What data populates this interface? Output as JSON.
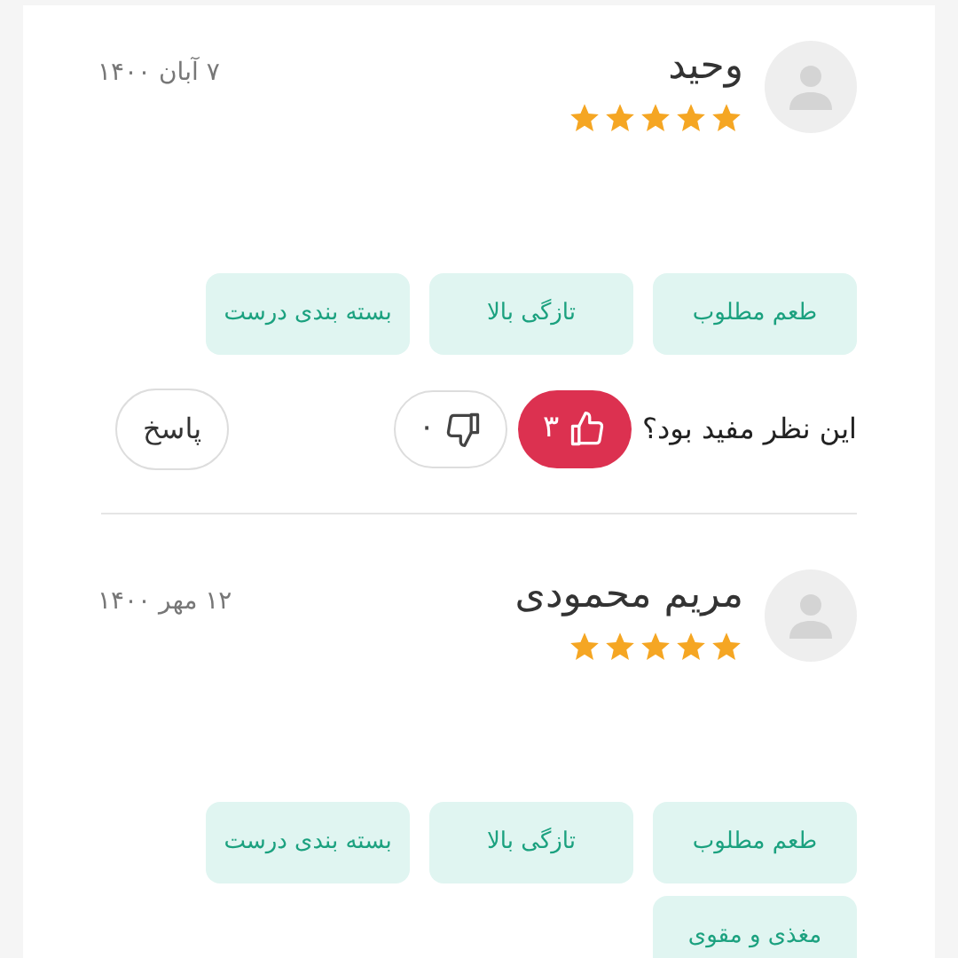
{
  "reviews": [
    {
      "name": "وحید",
      "stars": 5,
      "date": "۷ آبان ۱۴۰۰",
      "tags": [
        "طعم مطلوب",
        "تازگی بالا",
        "بسته بندی درست"
      ],
      "helpful": {
        "question": "این نظر مفید بود؟",
        "likes": "۳",
        "liked": true,
        "dislikes": "۰",
        "disliked": false,
        "reply": "پاسخ"
      }
    },
    {
      "name": "مریم محمودی",
      "stars": 5,
      "date": "۱۲ مهر ۱۴۰۰",
      "tags": [
        "طعم مطلوب",
        "تازگی بالا",
        "بسته بندی درست",
        "مغذی و مقوی"
      ]
    }
  ]
}
